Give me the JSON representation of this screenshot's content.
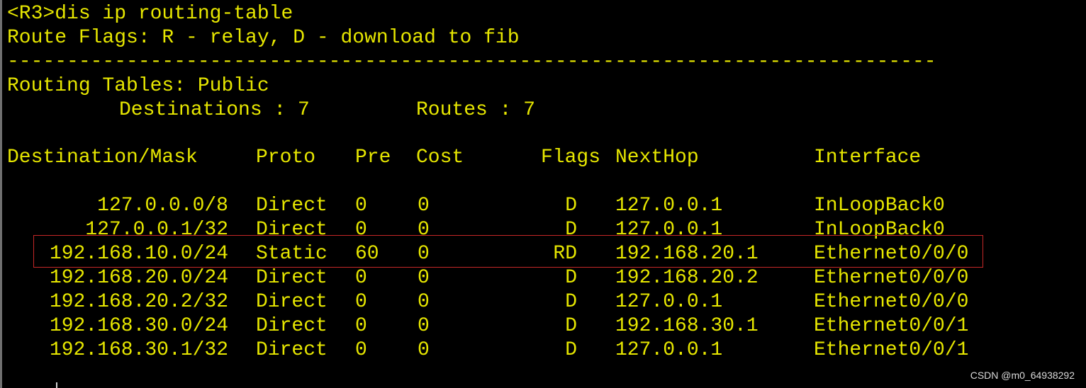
{
  "terminal": {
    "command_line": "<R3>dis ip routing-table",
    "flags_line": "Route Flags: R - relay, D - download to fib",
    "separator": "------------------------------------------------------------------------------",
    "table_heading": "Routing Tables: Public",
    "summary": {
      "destinations_label": "Destinations : 7",
      "routes_label": "Routes : 7"
    },
    "columns": {
      "destination": "Destination/Mask",
      "proto": "Proto",
      "pre": "Pre",
      "cost": "Cost",
      "flags": "Flags",
      "nexthop": "NextHop",
      "interface": "Interface"
    },
    "rows": [
      {
        "destination": "127.0.0.0/8",
        "proto": "Direct",
        "pre": "0",
        "cost": "0",
        "flags": "D",
        "nexthop": "127.0.0.1",
        "interface": "InLoopBack0"
      },
      {
        "destination": "127.0.0.1/32",
        "proto": "Direct",
        "pre": "0",
        "cost": "0",
        "flags": "D",
        "nexthop": "127.0.0.1",
        "interface": "InLoopBack0"
      },
      {
        "destination": "192.168.10.0/24",
        "proto": "Static",
        "pre": "60",
        "cost": "0",
        "flags": "RD",
        "nexthop": "192.168.20.1",
        "interface": "Ethernet0/0/0"
      },
      {
        "destination": "192.168.20.0/24",
        "proto": "Direct",
        "pre": "0",
        "cost": "0",
        "flags": "D",
        "nexthop": "192.168.20.2",
        "interface": "Ethernet0/0/0"
      },
      {
        "destination": "192.168.20.2/32",
        "proto": "Direct",
        "pre": "0",
        "cost": "0",
        "flags": "D",
        "nexthop": "127.0.0.1",
        "interface": "Ethernet0/0/0"
      },
      {
        "destination": "192.168.30.0/24",
        "proto": "Direct",
        "pre": "0",
        "cost": "0",
        "flags": "D",
        "nexthop": "192.168.30.1",
        "interface": "Ethernet0/0/1"
      },
      {
        "destination": "192.168.30.1/32",
        "proto": "Direct",
        "pre": "0",
        "cost": "0",
        "flags": "D",
        "nexthop": "127.0.0.1",
        "interface": "Ethernet0/0/1"
      }
    ]
  },
  "watermark": "CSDN @m0_64938292",
  "colors": {
    "text": "#e6e600",
    "background": "#000000",
    "highlight_border": "#c62828"
  }
}
